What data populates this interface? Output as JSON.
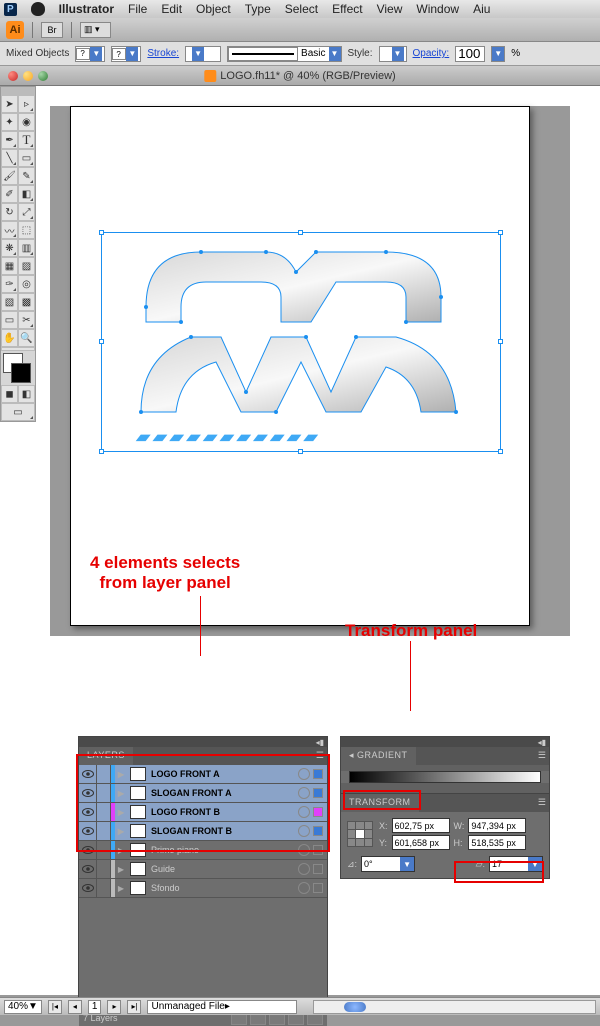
{
  "menubar": {
    "app": "Illustrator",
    "items": [
      "File",
      "Edit",
      "Object",
      "Type",
      "Select",
      "Effect",
      "View",
      "Window",
      "Aiu"
    ]
  },
  "appbar": {
    "ai": "Ai",
    "br": "Br"
  },
  "controlbar": {
    "selection": "Mixed Objects",
    "stroke_label": "Stroke:",
    "basic": "Basic",
    "style_label": "Style:",
    "opacity_label": "Opacity:",
    "opacity_value": "100",
    "percent": "%"
  },
  "window": {
    "title": "LOGO.fh11* @ 40% (RGB/Preview)"
  },
  "annotations": {
    "layers": "4 elements selects\n  from layer panel",
    "transform": "Transform panel"
  },
  "layers_panel": {
    "title": "LAYERS",
    "rows": [
      {
        "name": "LOGO FRONT A",
        "sel": true,
        "color": "#3fa9f5",
        "selbox": "#3a7ad6"
      },
      {
        "name": "SLOGAN FRONT A",
        "sel": true,
        "color": "#3fa9f5",
        "selbox": "#3a7ad6"
      },
      {
        "name": "LOGO FRONT B",
        "sel": true,
        "color": "#e040fb",
        "selbox": "#e040fb"
      },
      {
        "name": "SLOGAN FRONT B",
        "sel": true,
        "color": "#3fa9f5",
        "selbox": "#3a7ad6"
      },
      {
        "name": "Primo piano",
        "sel": false,
        "color": "#3fa9f5",
        "selbox": ""
      },
      {
        "name": "Guide",
        "sel": false,
        "color": "#bbb",
        "selbox": ""
      },
      {
        "name": "Sfondo",
        "sel": false,
        "color": "#bbb",
        "selbox": ""
      }
    ],
    "footer": "7 Layers"
  },
  "gradient_panel": {
    "title": "GRADIENT"
  },
  "transform_panel": {
    "title": "TRANSFORM",
    "x_label": "X:",
    "x": "602,75 px",
    "y_label": "Y:",
    "y": "601,658 px",
    "w_label": "W:",
    "w": "947,394 px",
    "h_label": "H:",
    "h": "518,535 px",
    "rotate": "0°",
    "shear": "17"
  },
  "statusbar": {
    "zoom": "40%",
    "page": "1",
    "doc_status": "Unmanaged File"
  }
}
